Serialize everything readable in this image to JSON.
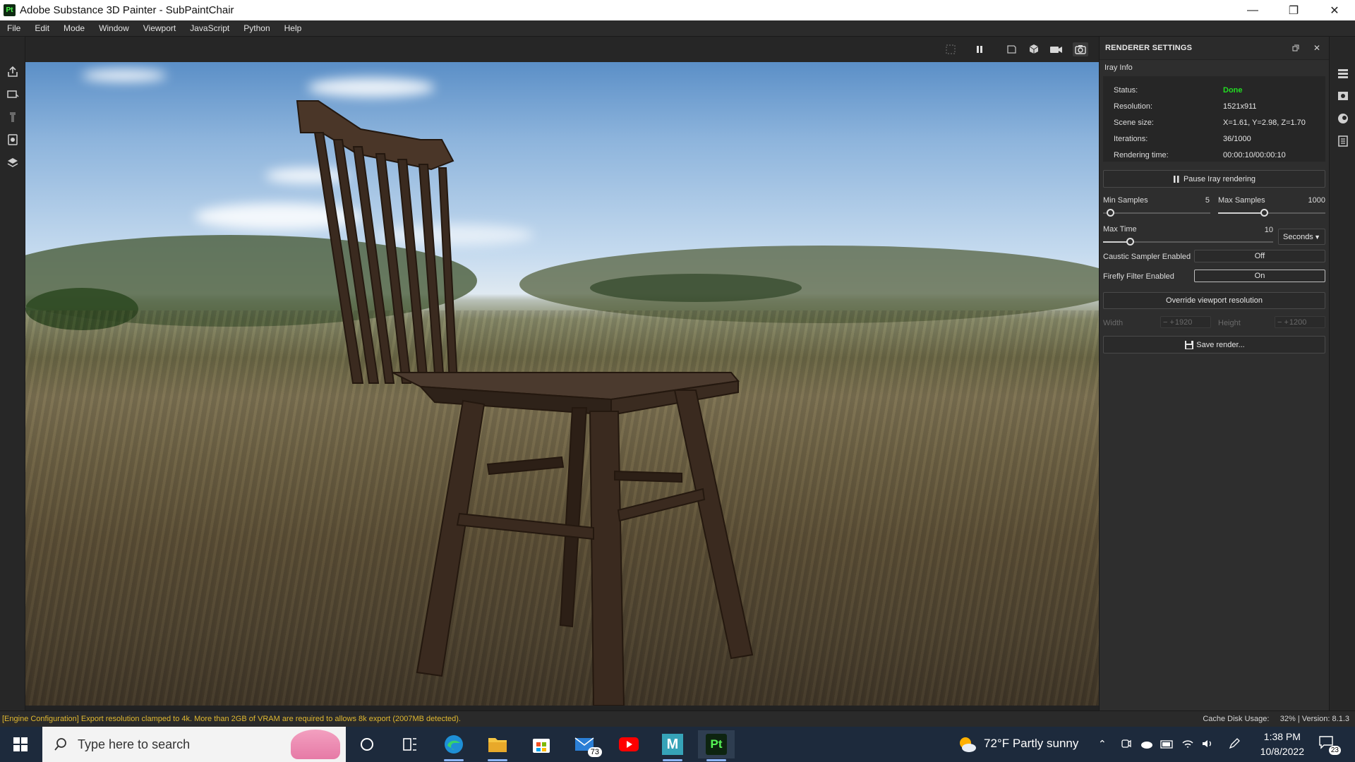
{
  "window": {
    "app_icon_label": "Pt",
    "title": "Adobe Substance 3D Painter - SubPaintChair",
    "minimize": "—",
    "maximize": "❐",
    "close": "✕"
  },
  "menu": [
    "File",
    "Edit",
    "Mode",
    "Window",
    "Viewport",
    "JavaScript",
    "Python",
    "Help"
  ],
  "left_toolbar": {
    "icons": [
      "export-icon",
      "bake-icon",
      "brush-icon",
      "projection-icon",
      "shelf-icon"
    ]
  },
  "viewport_toolbar": {
    "icons": [
      "frame-icon",
      "pause-icon",
      "view-single-icon",
      "cube-view-icon",
      "camera-icon",
      "screenshot-icon"
    ]
  },
  "renderer": {
    "panel_title": "RENDERER SETTINGS",
    "section": "Iray Info",
    "info": [
      {
        "label": "Status:",
        "value": "Done"
      },
      {
        "label": "Resolution:",
        "value": "1521x911"
      },
      {
        "label": "Scene size:",
        "value": "X=1.61, Y=2.98, Z=1.70"
      },
      {
        "label": "Iterations:",
        "value": "36/1000"
      },
      {
        "label": "Rendering time:",
        "value": "00:00:10/00:00:10"
      }
    ],
    "status_color": "#22dd22",
    "pause_label": "Pause Iray rendering",
    "min_samples_label": "Min Samples",
    "min_samples_value": "5",
    "max_samples_label": "Max Samples",
    "max_samples_value": "1000",
    "max_time_label": "Max Time",
    "max_time_value": "10",
    "time_unit": "Seconds",
    "caustic_label": "Caustic Sampler Enabled",
    "caustic_value": "Off",
    "firefly_label": "Firefly Filter Enabled",
    "firefly_value": "On",
    "override_label": "Override viewport resolution",
    "width_label": "Width",
    "width_value": "1920",
    "height_label": "Height",
    "height_value": "1200",
    "save_label": "Save render..."
  },
  "right_strip": {
    "icons": [
      "layers-icon",
      "texture-set-icon",
      "display-settings-icon",
      "shader-icon"
    ]
  },
  "status_bar": {
    "message": "[Engine Configuration] Export resolution clamped to 4k. More than 2GB of VRAM are required to allows 8k export (2007MB detected).",
    "cache": "Cache Disk Usage:     32% | Version: 8.1.3"
  },
  "taskbar": {
    "search_placeholder": "Type here to search",
    "mail_badge": "73",
    "maya_label": "M",
    "painter_label": "Pt",
    "weather": "72°F  Partly sunny",
    "time": "1:38 PM",
    "date": "10/8/2022",
    "notifications": "23"
  }
}
